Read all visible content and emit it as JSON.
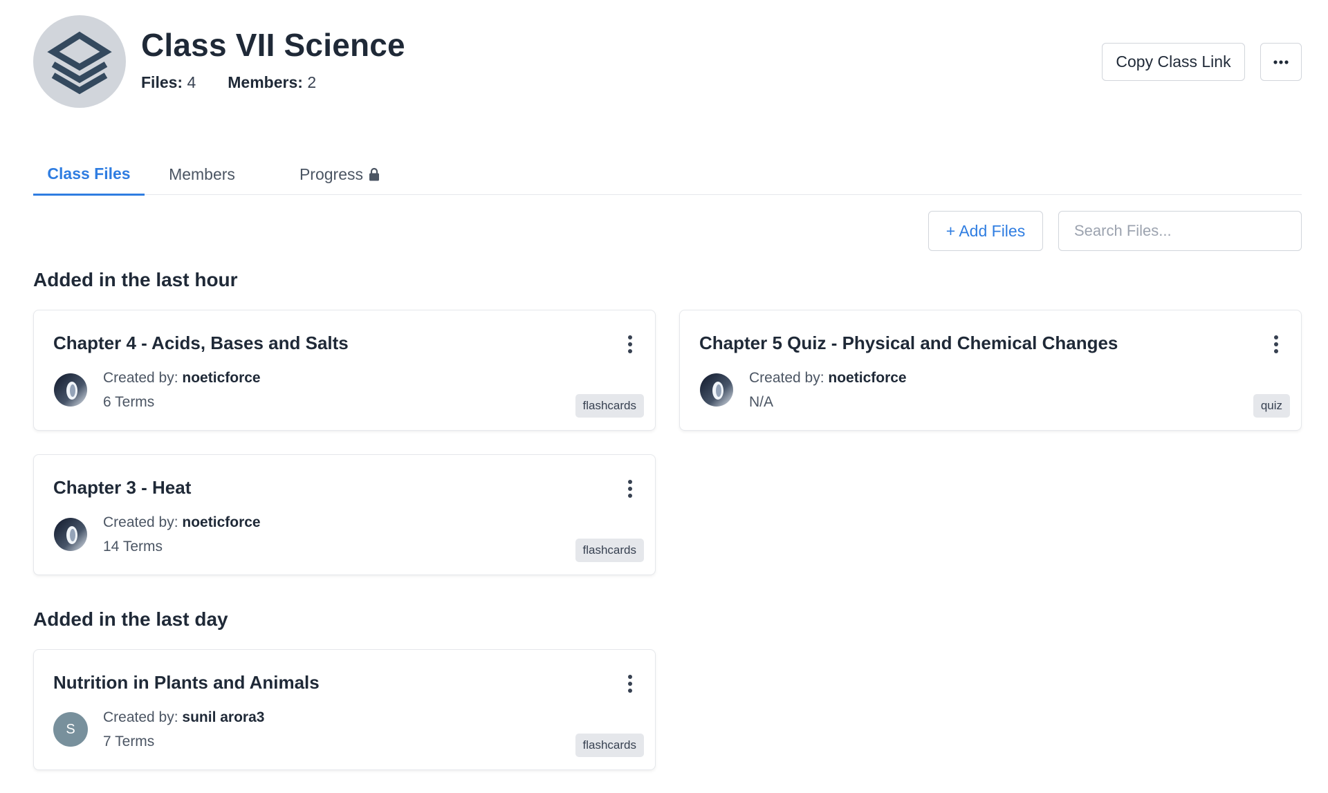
{
  "class": {
    "title": "Class VII Science",
    "files_label": "Files:",
    "files_count": "4",
    "members_label": "Members:",
    "members_count": "2",
    "icon": "stacked-layers-icon"
  },
  "header_actions": {
    "copy_link_label": "Copy Class Link",
    "more_icon": "ellipsis-icon"
  },
  "tabs": [
    {
      "label": "Class Files",
      "active": true
    },
    {
      "label": "Members",
      "active": false
    },
    {
      "label": "Progress",
      "active": false,
      "icon": "lock-icon"
    }
  ],
  "toolbar": {
    "add_files_label": "+ Add Files",
    "search_placeholder": "Search Files..."
  },
  "sections": [
    {
      "title": "Added in the last hour",
      "files": [
        {
          "title": "Chapter 4 - Acids, Bases and Salts",
          "created_by_label": "Created by:",
          "creator": "noeticforce",
          "count": "6 Terms",
          "tag": "flashcards"
        },
        {
          "title": "Chapter 5 Quiz - Physical and Chemical Changes",
          "created_by_label": "Created by:",
          "creator": "noeticforce",
          "count": "N/A",
          "tag": "quiz"
        },
        {
          "title": "Chapter 3 - Heat",
          "created_by_label": "Created by:",
          "creator": "noeticforce",
          "count": "14 Terms",
          "tag": "flashcards"
        }
      ]
    },
    {
      "title": "Added in the last day",
      "files": [
        {
          "title": "Nutrition in Plants and Animals",
          "created_by_label": "Created by:",
          "creator": "sunil arora3",
          "count": "7 Terms",
          "tag": "flashcards",
          "avatar_initial": "S"
        }
      ]
    }
  ],
  "colors": {
    "accent": "#2f7de1",
    "avatar_bg": "#d1d5db",
    "initial_avatar_bg": "#78909c"
  }
}
